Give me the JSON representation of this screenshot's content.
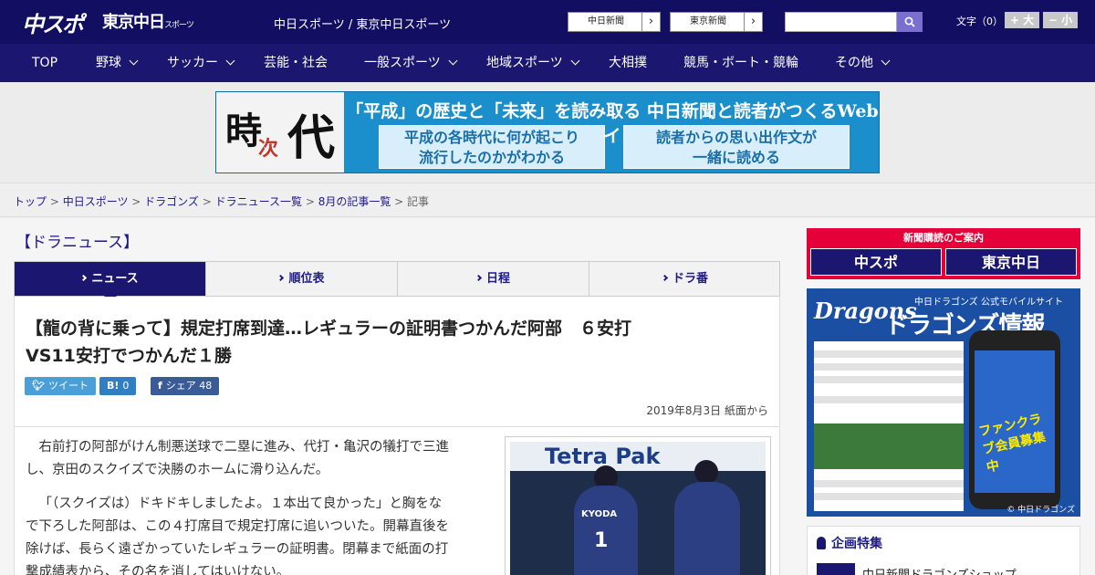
{
  "header": {
    "logo_main": "中スポ",
    "logo_tokyo": "東京中日",
    "logo_tokyo_sub": "スポーツ",
    "site_name": "中日スポーツ / 東京中日スポーツ",
    "paper_links": [
      "中日新聞",
      "東京新聞"
    ],
    "fontsize_label": "文字（0）",
    "fontsize_up": "+ 大",
    "fontsize_down": "− 小",
    "accent_color": "#120f63"
  },
  "nav": {
    "items": [
      {
        "label": "TOP",
        "dropdown": false
      },
      {
        "label": "野球",
        "dropdown": true
      },
      {
        "label": "サッカー",
        "dropdown": true
      },
      {
        "label": "芸能・社会",
        "dropdown": false
      },
      {
        "label": "一般スポーツ",
        "dropdown": true
      },
      {
        "label": "地域スポーツ",
        "dropdown": true
      },
      {
        "label": "大相撲",
        "dropdown": false
      },
      {
        "label": "競馬・ボート・競輪",
        "dropdown": false
      },
      {
        "label": "その他",
        "dropdown": true
      }
    ]
  },
  "banner": {
    "k1": "時",
    "k2": "次",
    "k3": "代",
    "headline": "「平成」の歴史と「未来」を読み取る 中日新聞と読者がつくるWebサイト",
    "box1_line1": "平成の各時代に何が起こり",
    "box1_line2": "流行したのかがわかる",
    "box2_line1": "読者からの思い出作文が",
    "box2_line2": "一緒に読める"
  },
  "breadcrumb": {
    "items": [
      "トップ",
      "中日スポーツ",
      "ドラゴンズ",
      "ドラニュース一覧",
      "8月の記事一覧"
    ],
    "current": "記事"
  },
  "section_title": "【ドラニュース】",
  "tabs": [
    {
      "label": "ニュース",
      "active": true
    },
    {
      "label": "順位表",
      "active": false
    },
    {
      "label": "日程",
      "active": false
    },
    {
      "label": "ドラ番",
      "active": false
    }
  ],
  "article": {
    "headline_line1": "【龍の背に乗って】規定打席到達…レギュラーの証明書つかんだ阿部　６安打",
    "headline_line2": "VS11安打でつかんだ１勝",
    "share": {
      "tweet_label": "ツイート",
      "hatena_label": "0",
      "facebook_label": "シェア",
      "facebook_count": "48"
    },
    "dateline": "2019年8月3日 紙面から",
    "para1_line1": "右前打の阿部がけん制悪送球で二塁に進み、代打・亀沢の犠打で三進",
    "para1_line2": "し、京田のスクイズで決勝のホームに滑り込んだ。",
    "para2_line1": "「（スクイズは）ドキドキしましたよ。１本出て良かった」と胸をな",
    "para2_line2": "で下ろした阿部は、この４打席目で規定打席に追いついた。開幕直後を",
    "para2_line3": "除けば、長らく遠ざかっていたレギュラーの証明書。閉幕まで紙面の打",
    "para2_line4": "撃成績表から、その名を消してはいけない。",
    "photo_wall_text": "Tetra Pak",
    "photo_uniform_name": "KYODA",
    "photo_uniform_number": "1"
  },
  "sidebar": {
    "subscribe_title": "新聞購読のご案内",
    "subscribe_left": "中スポ",
    "subscribe_right": "東京中日",
    "ad_logo": "Dragons",
    "ad_sub": "中日ドラゴンズ 公式モバイルサイト",
    "ad_title": "ドラゴンズ情報",
    "ad_phone_text": "ファンクラブ会員募集中",
    "ad_copyright": "© 中日ドラゴンズ",
    "special_title": "企画特集",
    "special_item": "中日新聞ドラゴンズショップ"
  }
}
